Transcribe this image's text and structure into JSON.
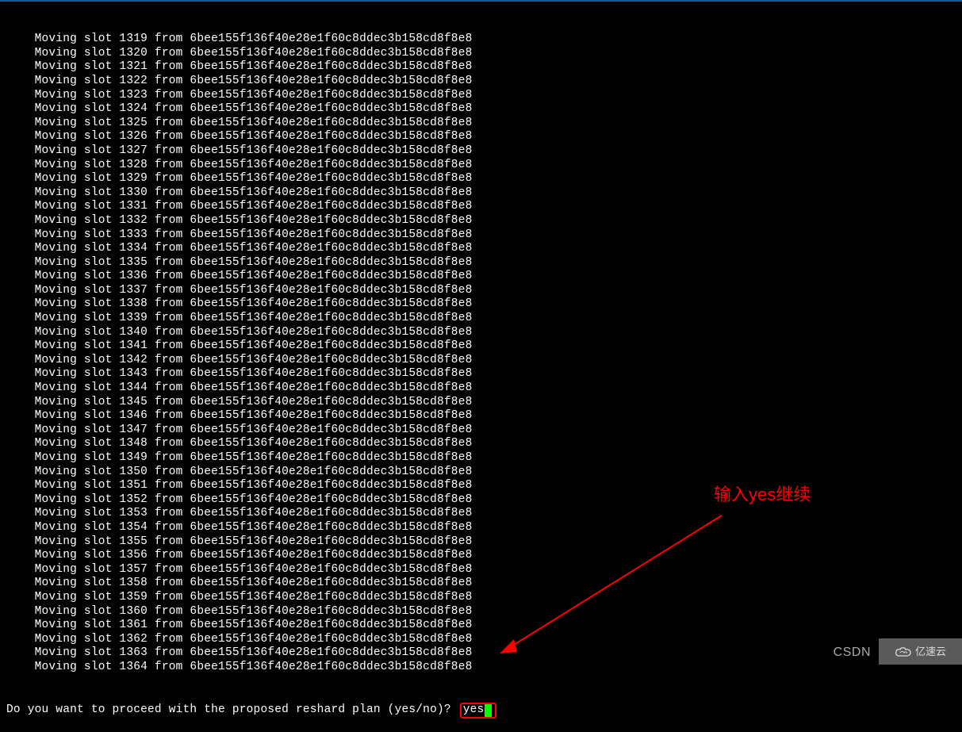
{
  "terminal": {
    "indent": "    ",
    "line_prefix": "Moving slot ",
    "line_middle": " from ",
    "node_id": "6bee155f136f40e28e1f60c8ddec3b158cd8f8e8",
    "slot_start": 1319,
    "slot_end": 1364,
    "prompt": "Do you want to proceed with the proposed reshard plan (yes/no)? ",
    "input_value": "yes"
  },
  "annotation": {
    "text": "输入yes继续"
  },
  "watermarks": {
    "csdn": "CSDN",
    "yisu": "亿速云"
  },
  "colors": {
    "highlight": "#ff0000",
    "cursor": "#00ff00"
  }
}
